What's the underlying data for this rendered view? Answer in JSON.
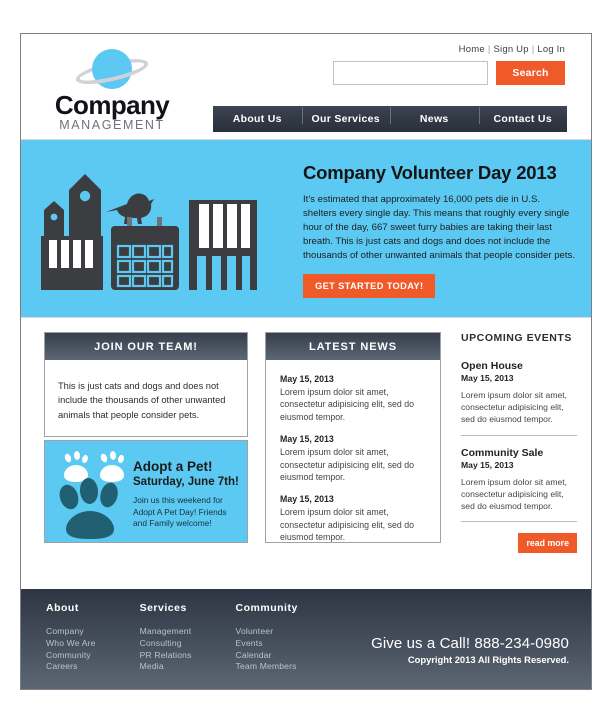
{
  "header": {
    "logo": {
      "main": "Company",
      "sub": "MANAGEMENT",
      "icon": "planet-icon"
    },
    "top_links": [
      {
        "label": "Home"
      },
      {
        "label": "Sign Up"
      },
      {
        "label": "Log In"
      }
    ],
    "separator": "|",
    "search": {
      "value": "",
      "placeholder": "",
      "button_label": "Search"
    },
    "nav": [
      {
        "label": "About Us"
      },
      {
        "label": "Our Services"
      },
      {
        "label": "News"
      },
      {
        "label": "Contact Us"
      }
    ]
  },
  "hero": {
    "title": "Company Volunteer Day 2013",
    "body": "It's estimated that approximately 16,000 pets die in U.S. shelters every single day. This means that roughly every single hour of the day, 667 sweet furry babies are taking their last breath. This is just cats and dogs and does not include the thousands of other unwanted animals that people consider pets.",
    "cta_label": "GET STARTED TODAY!",
    "illustration": "city-calendar-bird-icon"
  },
  "join": {
    "heading": "JOIN OUR TEAM!",
    "body": "This is just cats and dogs and does not include the thousands of other unwanted animals that people consider pets."
  },
  "adopt": {
    "title": "Adopt a Pet!",
    "subtitle": "Saturday, June 7th!",
    "body": "Join us this weekend for Adopt A Pet Day! Friends and Family welcome!",
    "icon": "paw-print-icon"
  },
  "news": {
    "heading": "LATEST NEWS",
    "items": [
      {
        "date": "May 15, 2013",
        "text": "Lorem ipsum dolor sit amet, consectetur adipisicing elit, sed do eiusmod tempor."
      },
      {
        "date": "May 15, 2013",
        "text": "Lorem ipsum dolor sit amet, consectetur adipisicing elit, sed do eiusmod tempor."
      },
      {
        "date": "May 15, 2013",
        "text": "Lorem ipsum dolor sit amet, consectetur adipisicing elit, sed do eiusmod tempor."
      }
    ]
  },
  "events": {
    "heading": "UPCOMING EVENTS",
    "items": [
      {
        "name": "Open House",
        "date": "May 15, 2013",
        "text": "Lorem ipsum dolor sit amet, consectetur adipisicing elit, sed do eiusmod tempor."
      },
      {
        "name": "Community Sale",
        "date": "May 15, 2013",
        "text": "Lorem ipsum dolor sit amet, consectetur adipisicing elit, sed do eiusmod tempor."
      }
    ],
    "read_more_label": "read more"
  },
  "footer": {
    "columns": [
      {
        "title": "About",
        "links": [
          "Company",
          "Who We Are",
          "Community",
          "Careers"
        ]
      },
      {
        "title": "Services",
        "links": [
          "Management",
          "Consulting",
          "PR Relations",
          "Media"
        ]
      },
      {
        "title": "Community",
        "links": [
          "Volunteer",
          "Events",
          "Calendar",
          "Team Members"
        ]
      }
    ],
    "call": "Give us a Call! 888-234-0980",
    "copyright": "Copyright 2013 All Rights Reserved."
  },
  "colors": {
    "hero_blue": "#5BC9F2",
    "accent_orange": "#F05A28",
    "panel_dark": "#363E4B",
    "panel_light": "#5D6673",
    "footer_top": "#2F3643",
    "border_gray": "#7C7F86"
  }
}
